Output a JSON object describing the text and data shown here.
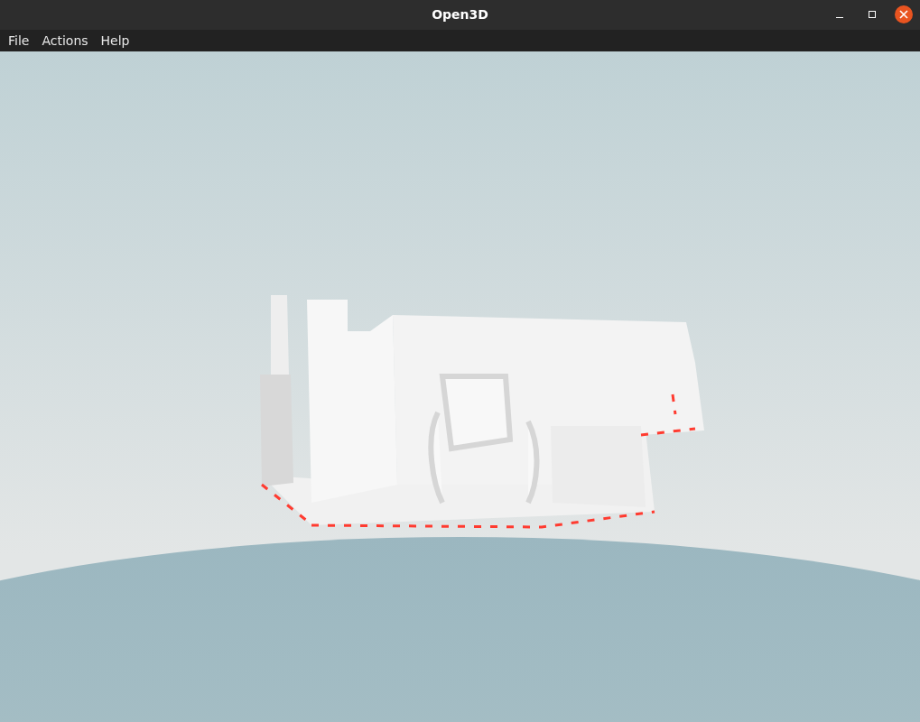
{
  "window": {
    "title": "Open3D"
  },
  "menu": [
    "File",
    "Actions",
    "Help"
  ]
}
